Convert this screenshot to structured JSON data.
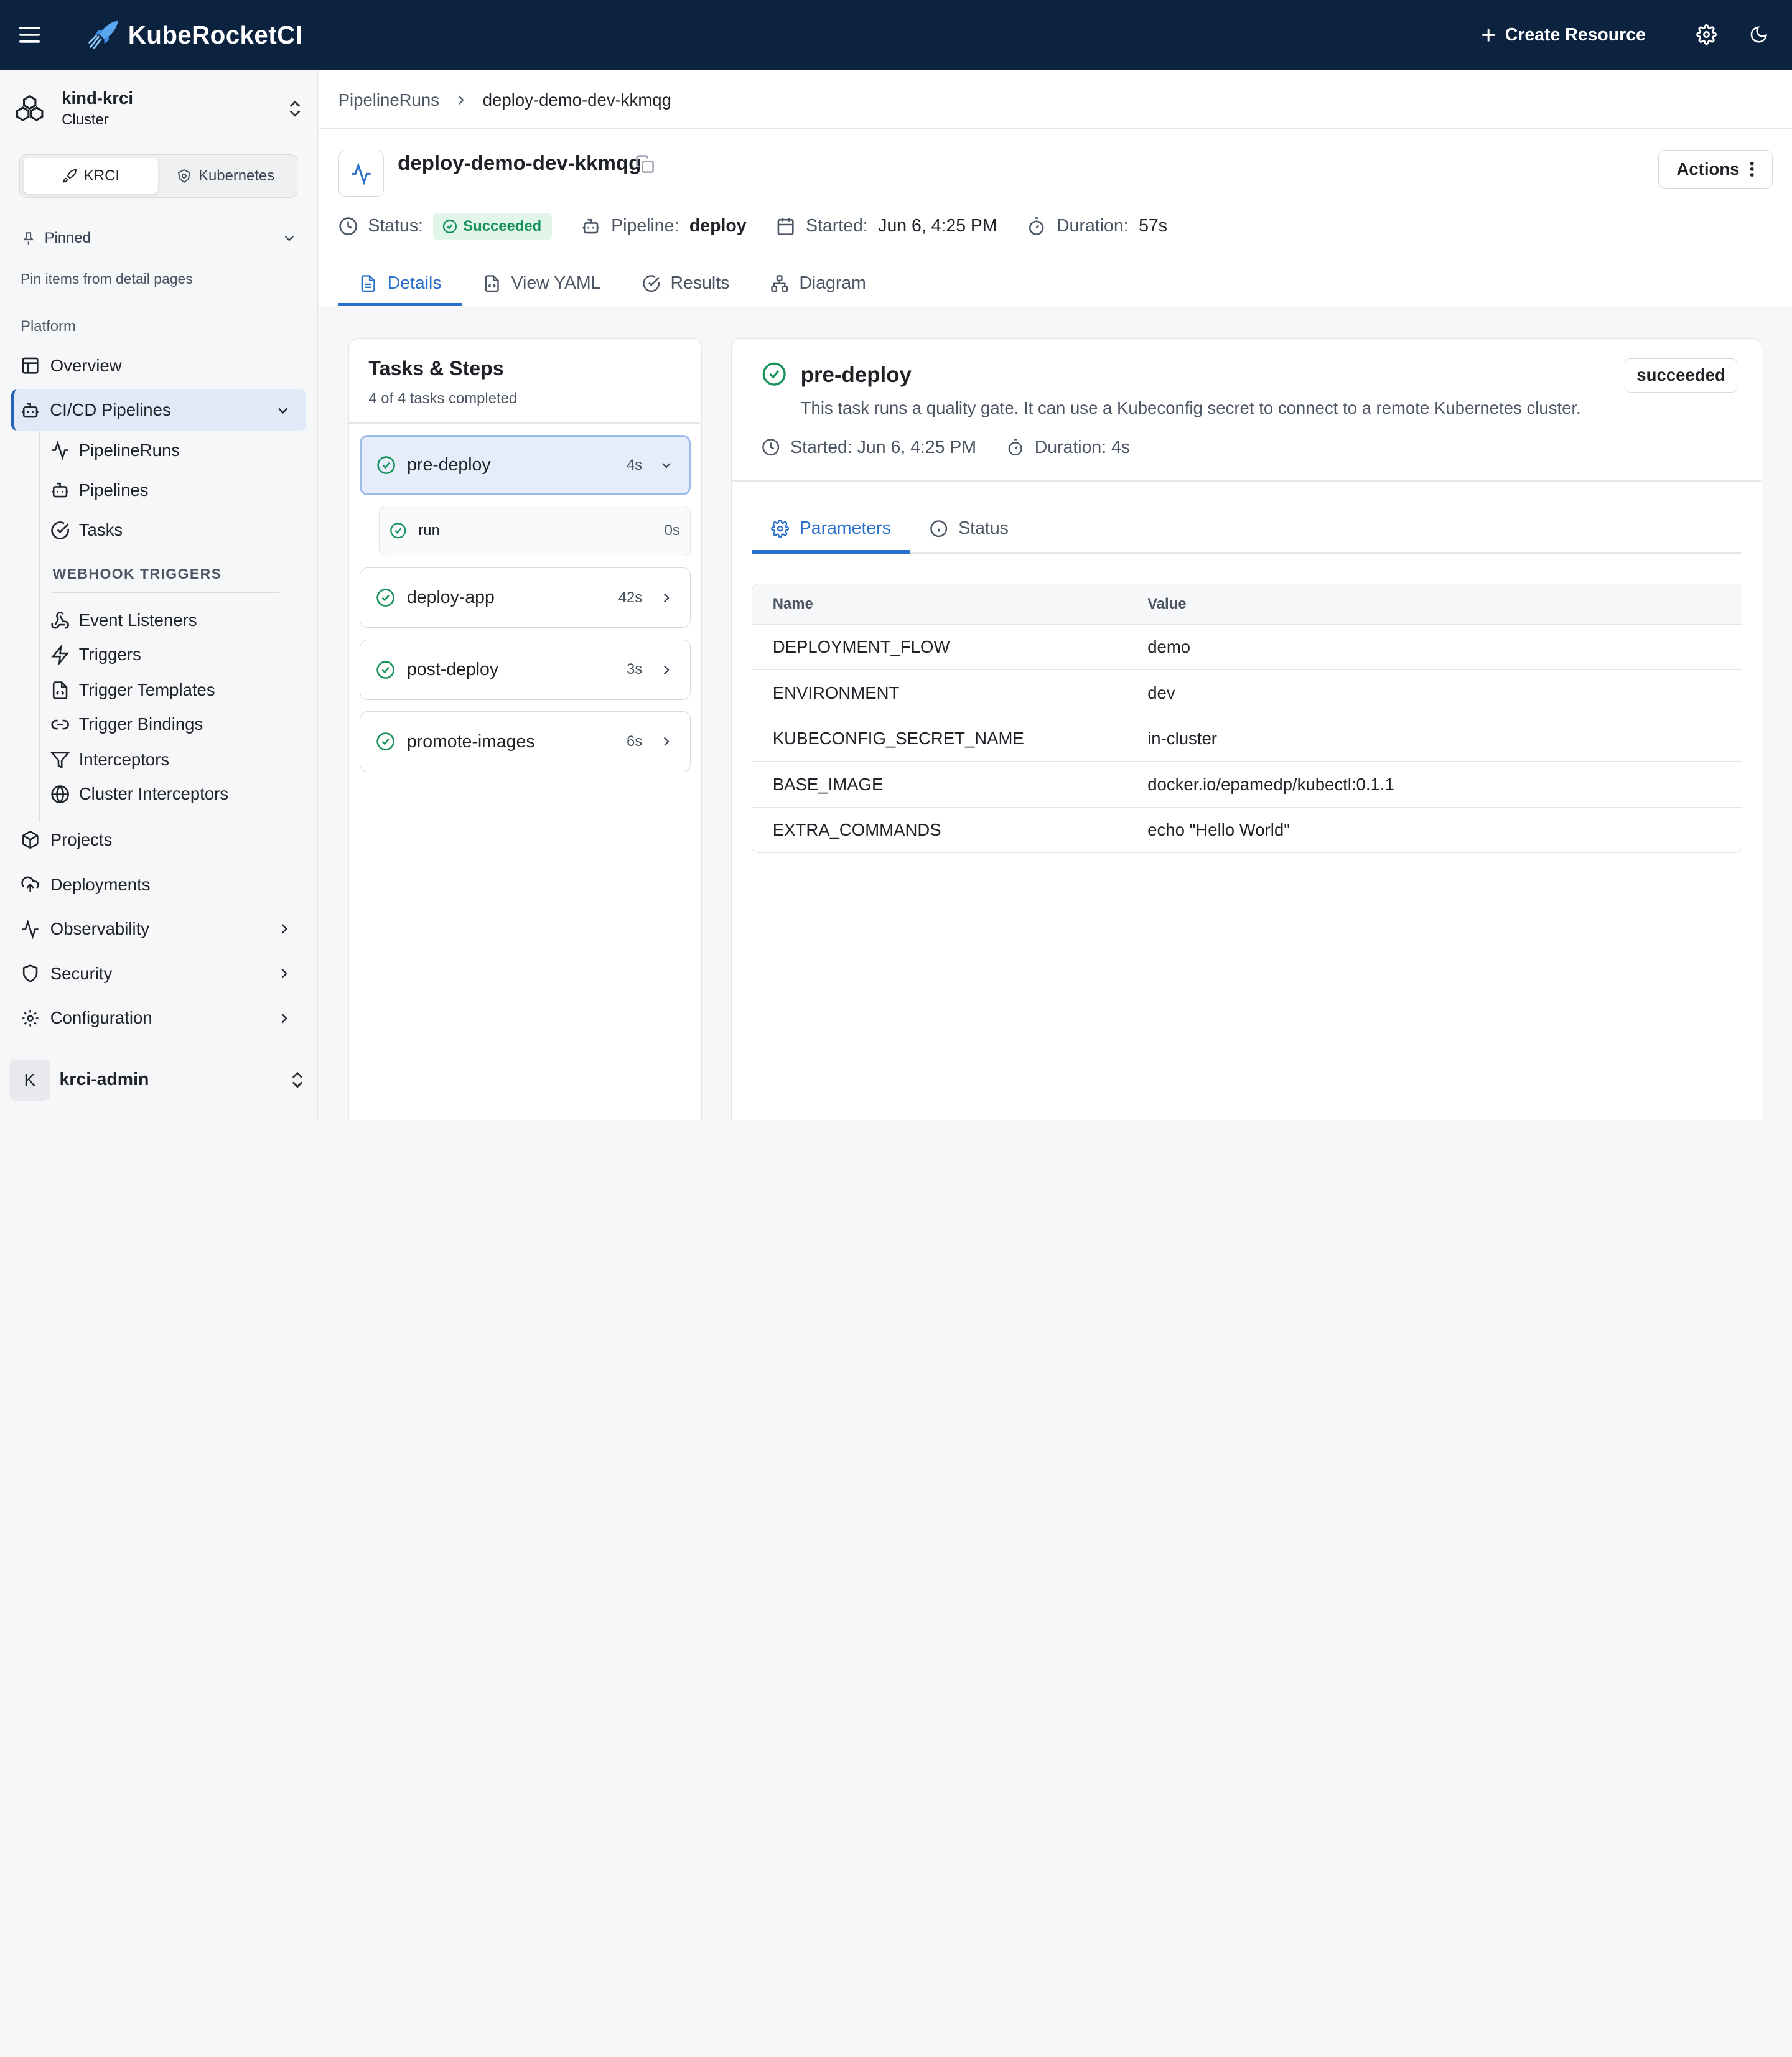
{
  "app": {
    "brand": "KubeRocketCI",
    "create_label": "Create Resource",
    "menu_icon": "hamburger-menu-icon",
    "settings_icon": "gear-icon",
    "theme_icon": "moon-icon"
  },
  "colors": {
    "topbar_bg": "#0c2340",
    "accent": "#2a6fc9",
    "success": "#16925a",
    "success_bg": "#e2f5ea",
    "active_nav_bg": "#dfe9f7"
  },
  "sidebar": {
    "cluster_name": "kind-krci",
    "cluster_type": "Cluster",
    "switch": [
      "KRCI",
      "Kubernetes"
    ],
    "pinned_label": "Pinned",
    "pinned_hint": "Pin items from detail pages",
    "section_label": "Platform",
    "nav": {
      "overview": "Overview",
      "cicd": "CI/CD Pipelines",
      "projects": "Projects",
      "deployments": "Deployments",
      "observability": "Observability",
      "security": "Security",
      "configuration": "Configuration"
    },
    "cicd_items": [
      "PipelineRuns",
      "Pipelines",
      "Tasks"
    ],
    "webhook_label": "WEBHOOK TRIGGERS",
    "webhook_items": [
      "Event Listeners",
      "Triggers",
      "Trigger Templates",
      "Trigger Bindings",
      "Interceptors",
      "Cluster Interceptors"
    ],
    "user_initial": "K",
    "user_name": "krci-admin"
  },
  "breadcrumb": {
    "parent": "PipelineRuns",
    "current": "deploy-demo-dev-kkmqg"
  },
  "run": {
    "name": "deploy-demo-dev-kkmqg",
    "actions_label": "Actions",
    "status_label": "Status:",
    "status_value": "Succeeded",
    "pipeline_label": "Pipeline:",
    "pipeline_value": "deploy",
    "started_label": "Started:",
    "started_value": "Jun 6, 4:25 PM",
    "duration_label": "Duration:",
    "duration_value": "57s"
  },
  "tabs": [
    "Details",
    "View YAML",
    "Results",
    "Diagram"
  ],
  "tasks_panel": {
    "title": "Tasks & Steps",
    "subtitle": "4 of 4 tasks completed",
    "tasks": [
      {
        "name": "pre-deploy",
        "duration": "4s"
      },
      {
        "name": "deploy-app",
        "duration": "42s"
      },
      {
        "name": "post-deploy",
        "duration": "3s"
      },
      {
        "name": "promote-images",
        "duration": "6s"
      }
    ],
    "step": {
      "name": "run",
      "duration": "0s"
    }
  },
  "detail": {
    "title": "pre-deploy",
    "badge": "succeeded",
    "description": "This task runs a quality gate. It can use a Kubeconfig secret to connect to a remote Kubernetes cluster.",
    "started": "Started: Jun 6, 4:25 PM",
    "duration": "Duration: 4s",
    "tabs": [
      "Parameters",
      "Status"
    ],
    "params_header": {
      "name": "Name",
      "value": "Value"
    },
    "params": [
      {
        "name": "DEPLOYMENT_FLOW",
        "value": "demo"
      },
      {
        "name": "ENVIRONMENT",
        "value": "dev"
      },
      {
        "name": "KUBECONFIG_SECRET_NAME",
        "value": "in-cluster"
      },
      {
        "name": "BASE_IMAGE",
        "value": "docker.io/epamedp/kubectl:0.1.1"
      },
      {
        "name": "EXTRA_COMMANDS",
        "value": "echo \"Hello World\""
      }
    ]
  }
}
